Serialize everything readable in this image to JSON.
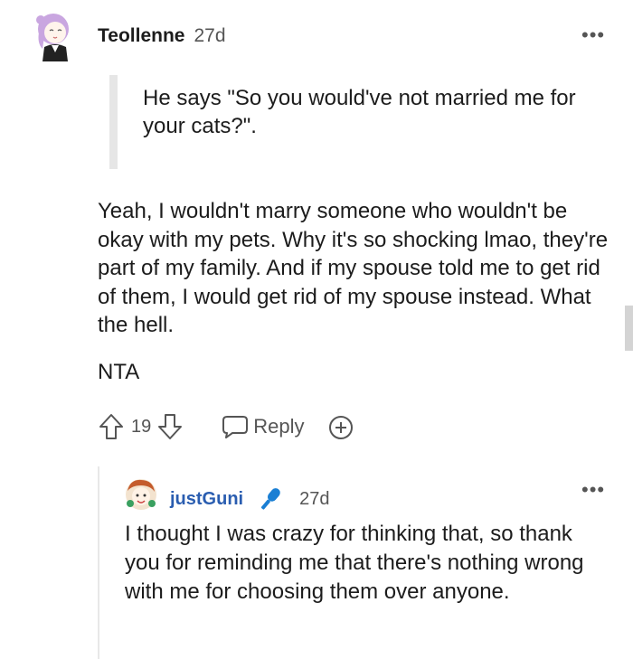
{
  "comment": {
    "username": "Teollenne",
    "timestamp": "27d",
    "more_label": "•••",
    "quote": "He says \"So you would've not married me for your cats?\".",
    "body": "Yeah, I wouldn't marry someone who wouldn't be okay with my pets. Why it's so shocking lmao, they're part of my family. And if my spouse told me to get rid of them, I would get rid of my spouse instead. What the hell.",
    "body2": "NTA",
    "votes": "19",
    "reply_label": "Reply"
  },
  "reply": {
    "username": "justGuni",
    "timestamp": "27d",
    "more_label": "•••",
    "body": "I thought I was crazy for thinking that, so thank you for reminding me that there's nothing wrong with me for choosing them over anyone."
  },
  "icons": {
    "upvote": "arrow-up-icon",
    "downvote": "arrow-down-icon",
    "reply": "chat-bubble-icon",
    "award": "plus-circle-icon",
    "flair": "microphone-icon"
  },
  "colors": {
    "username_link": "#2a5db0",
    "flair_icon": "#1a7fd4",
    "muted": "#555555"
  }
}
